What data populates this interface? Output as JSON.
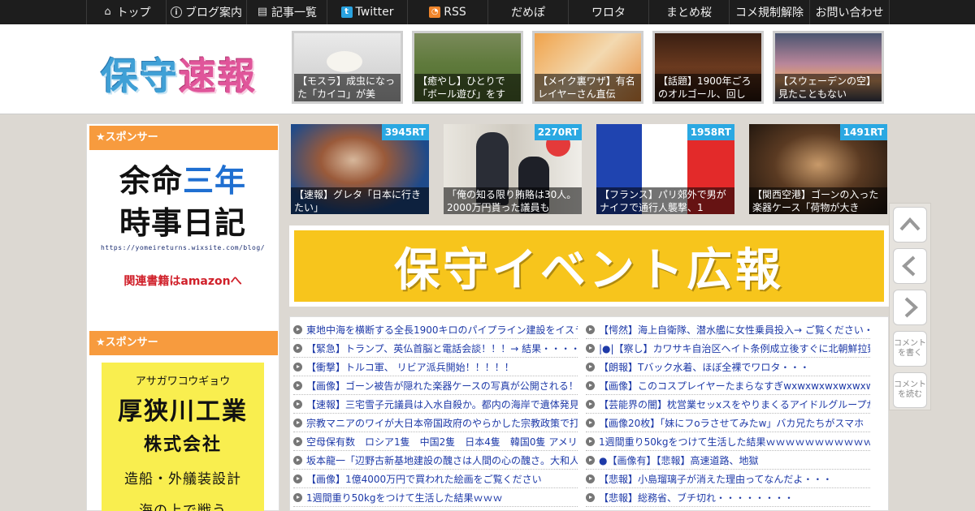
{
  "nav": {
    "items": [
      {
        "label": "トップ",
        "icon": "home-icon"
      },
      {
        "label": "ブログ案内",
        "icon": "info-icon"
      },
      {
        "label": "記事一覧",
        "icon": "list-icon"
      },
      {
        "label": "Twitter",
        "icon": "twitter-icon"
      },
      {
        "label": "RSS",
        "icon": "rss-icon"
      },
      {
        "label": "だめぽ"
      },
      {
        "label": "ワロタ"
      },
      {
        "label": "まとめ桜"
      },
      {
        "label": "コメ規制解除"
      },
      {
        "label": "お問い合わせ"
      }
    ]
  },
  "header": {
    "logo_part1": "保守",
    "logo_part2": "速報",
    "thumbs": [
      {
        "caption": "【モスラ】成虫になった「カイコ」が美"
      },
      {
        "caption": "【癒やし】ひとりで「ボール遊び」をす"
      },
      {
        "caption": "【メイク裏ワザ】有名レイヤーさん直伝"
      },
      {
        "caption": "【話題】1900年ごろのオルゴール、回し"
      },
      {
        "caption": "【スウェーデンの空】見たこともない"
      }
    ]
  },
  "sidebar": {
    "sponsor_head_1": "★スポンサー",
    "sponsor_head_2": "★スポンサー",
    "ad1": {
      "line1_a": "余命",
      "line1_b": "三年",
      "line2": "時事日記",
      "url": "https://yomeireturns.wixsite.com/blog/",
      "amazon": "関連書籍はamazonへ"
    },
    "ad2": {
      "kana": "アサガワコウギョウ",
      "name1": "厚狭川工業",
      "name2": "株式会社",
      "line3": "造船・外艤装設計",
      "line4": "海の上で戦う"
    }
  },
  "ranking": [
    {
      "rt": "3945RT",
      "caption": "【速報】グレタ「日本に行きたい」"
    },
    {
      "rt": "2270RT",
      "caption": "「俺の知る限り賄賂は30人。2000万円貰った議員も"
    },
    {
      "rt": "1958RT",
      "caption": "【フランス】パリ郊外で男がナイフで通行人襲撃、1"
    },
    {
      "rt": "1491RT",
      "caption": "【関西空港】ゴーンの入った楽器ケース「荷物が大き"
    }
  ],
  "banner": {
    "text": "保守イベント広報"
  },
  "links_left": [
    "東地中海を横断する全長1900キロのパイプライン建設をイスラ",
    "【緊急】トランプ、英仏首脳と電話会談！！！→ 結果・・・・",
    "【衝撃】トルコ軍、 リビア派兵開始！！！！！",
    "【画像】ゴーン被告が隠れた楽器ケースの写真が公開される！",
    "【速報】三宅雪子元議員は入水自殺か。都内の海岸で遺体発見",
    "宗教マニアのワイが大日本帝国政府のやらかした宗教政策で打",
    "空母保有数　ロシア1隻　中国2隻　日本4隻　韓国0隻 アメリカ",
    "坂本龍一「辺野古新基地建設の醜さは人間の心の醜さ。大和人",
    "【画像】1億4000万円で買われた絵画をご覧ください",
    "1週間重り50kgをつけて生活した結果ｗｗｗ"
  ],
  "links_right": [
    "【愕然】海上自衛隊、潜水艦に女性乗員投入→ ご覧ください・",
    "|●|【察し】カワサキ自治区ヘイト条例成立後すぐに北朝鮮拉致",
    "【朗報】Tバック水着、ほぼ全裸でワロタ・・・",
    "【画像】このコスプレイヤーたまらなすぎwxwxwxwxwxwxwxwxw",
    "【芸能界の闇】枕営業セッxスをやりまくるアイドルグループが",
    "【画像20枚】「妹にフoラさせてみたw」バカ兄たちがスマホ",
    "1週間重り50kgをつけて生活した結果ｗｗｗｗｗｗｗｗｗｗｗ",
    "●【画像有】【悲報】高速道路、地獄",
    "【悲報】小島瑠璃子が消えた理由ってなんだよ・・・",
    "【悲報】総務省、ブチ切れ・・・・・・・・"
  ],
  "float": {
    "write_comment": "コメントを書く",
    "read_comment": "コメントを読む"
  }
}
